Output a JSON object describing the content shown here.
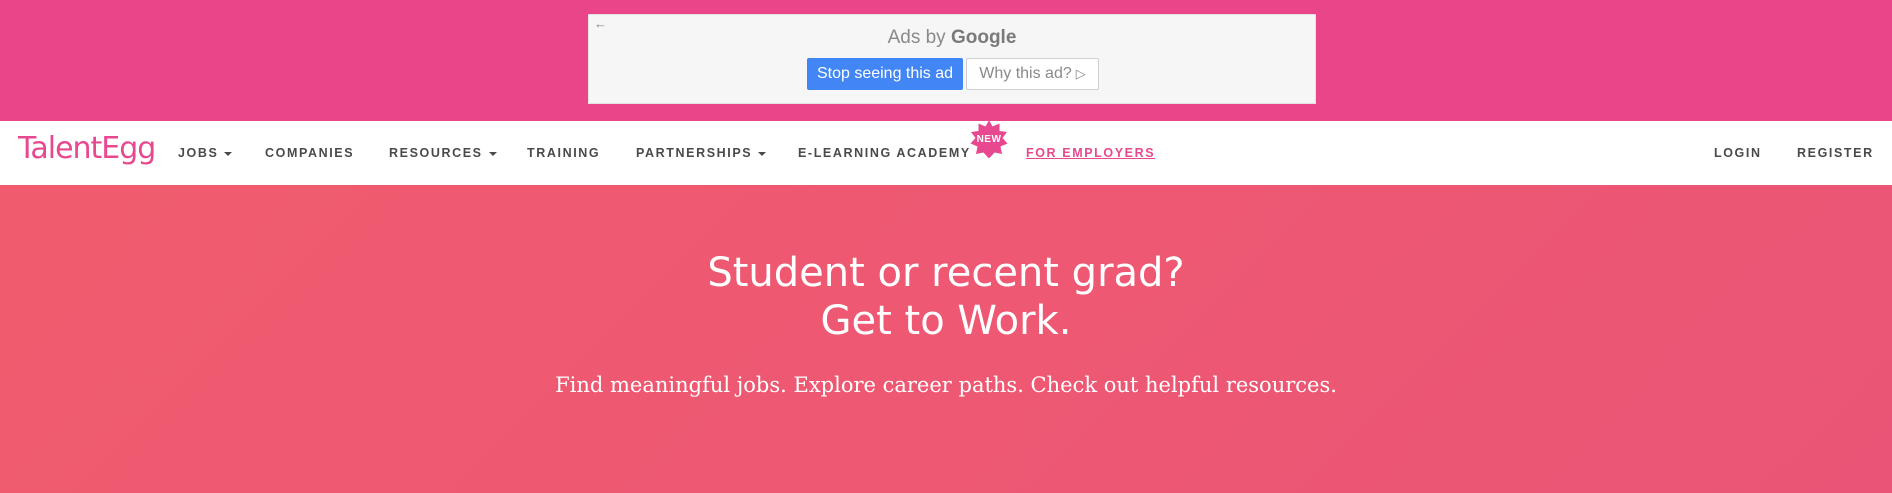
{
  "ad": {
    "back_icon": "back-arrow-icon",
    "ads_by": "Ads by",
    "google": "Google",
    "stop_label": "Stop seeing this ad",
    "why_label": "Why this ad?",
    "why_icon": "info-triangle-icon"
  },
  "nav": {
    "logo": "TalentEgg",
    "items": {
      "jobs": "Jobs",
      "companies": "Companies",
      "resources": "Resources",
      "training": "Training",
      "partnerships": "Partnerships",
      "elearning": "E-Learning Academy",
      "new_badge": "NEW",
      "employers": "For Employers",
      "login": "Login",
      "register": "Register"
    }
  },
  "hero": {
    "line1": "Student or recent grad?",
    "line2": "Get to Work.",
    "subtitle": "Find meaningful jobs. Explore career paths. Check out helpful resources."
  },
  "colors": {
    "ad_background": "#eb4589",
    "brand_pink": "#e8488f",
    "hero_background": "#ef5872"
  }
}
